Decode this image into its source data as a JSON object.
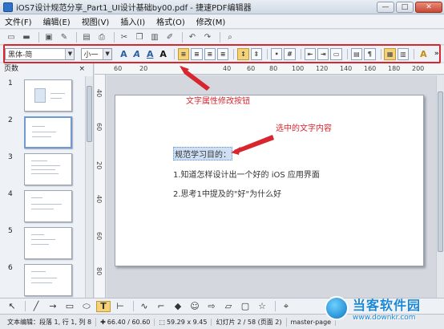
{
  "window": {
    "title": "iOS7设计规范分享_Part1_UI设计基础by00.pdf - 捷速PDF编辑器",
    "minimize": "—",
    "maximize": "□",
    "close": "✕"
  },
  "menu": [
    "文件(F)",
    "编辑(E)",
    "视图(V)",
    "插入(I)",
    "格式(O)",
    "修改(M)"
  ],
  "format_toolbar": {
    "font_name": "黑体-简",
    "font_size": "小一"
  },
  "side_panel": {
    "title": "页数",
    "close": "×",
    "pages": [
      "1",
      "2",
      "3",
      "4",
      "5",
      "6"
    ],
    "selected_page": "2"
  },
  "rulers": {
    "horizontal": [
      "60",
      "20",
      "40",
      "60",
      "80",
      "100",
      "120",
      "140",
      "160",
      "180",
      "200"
    ],
    "vertical": [
      "40",
      "60",
      "20",
      "40",
      "60",
      "80"
    ]
  },
  "document": {
    "line1": "规范学习目的：",
    "line2": "1.知道怎样设计出一个好的 iOS 应用界面",
    "line3": "2.思考1中提及的\"好\"为什么好"
  },
  "annotations": {
    "toolbar_note": "文字属性修改按钮",
    "selection_note": "选中的文字内容"
  },
  "status": {
    "mode": "文本编辑：段落 1, 行 1, 列 8",
    "position": "66.40 / 60.60",
    "size": "59.29 x 9.45",
    "page": "幻灯片 2 / 58 (页面 2)",
    "master": "master-page"
  },
  "watermark": {
    "title": "当客软件园",
    "url": "www.downkr.com"
  },
  "colors": {
    "annotation_red": "#d7262e",
    "selection_blue": "#5a8fd0"
  }
}
